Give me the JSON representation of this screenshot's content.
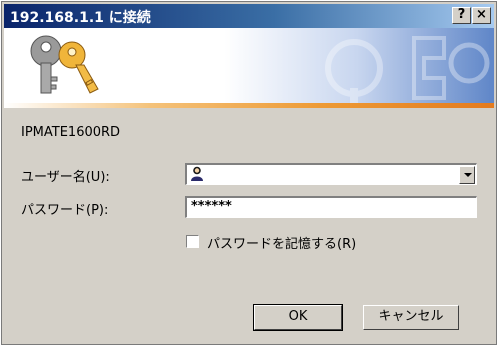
{
  "window": {
    "title": "192.168.1.1 に接続",
    "help_button": "?",
    "close_button": "×"
  },
  "dialog": {
    "realm": "IPMATE1600RD",
    "username_label": "ユーザー名(U):",
    "username_value": "",
    "password_label": "パスワード(P):",
    "password_value": "******",
    "remember_label": "パスワードを記憶する(R)",
    "remember_checked": false
  },
  "buttons": {
    "ok": "OK",
    "cancel": "キャンセル"
  },
  "icons": {
    "banner": "keys-icon",
    "user": "user-icon"
  },
  "colors": {
    "title_bar": "#0a246a",
    "dialog_bg": "#d4d0c8",
    "accent_line": "#ed9a35"
  }
}
